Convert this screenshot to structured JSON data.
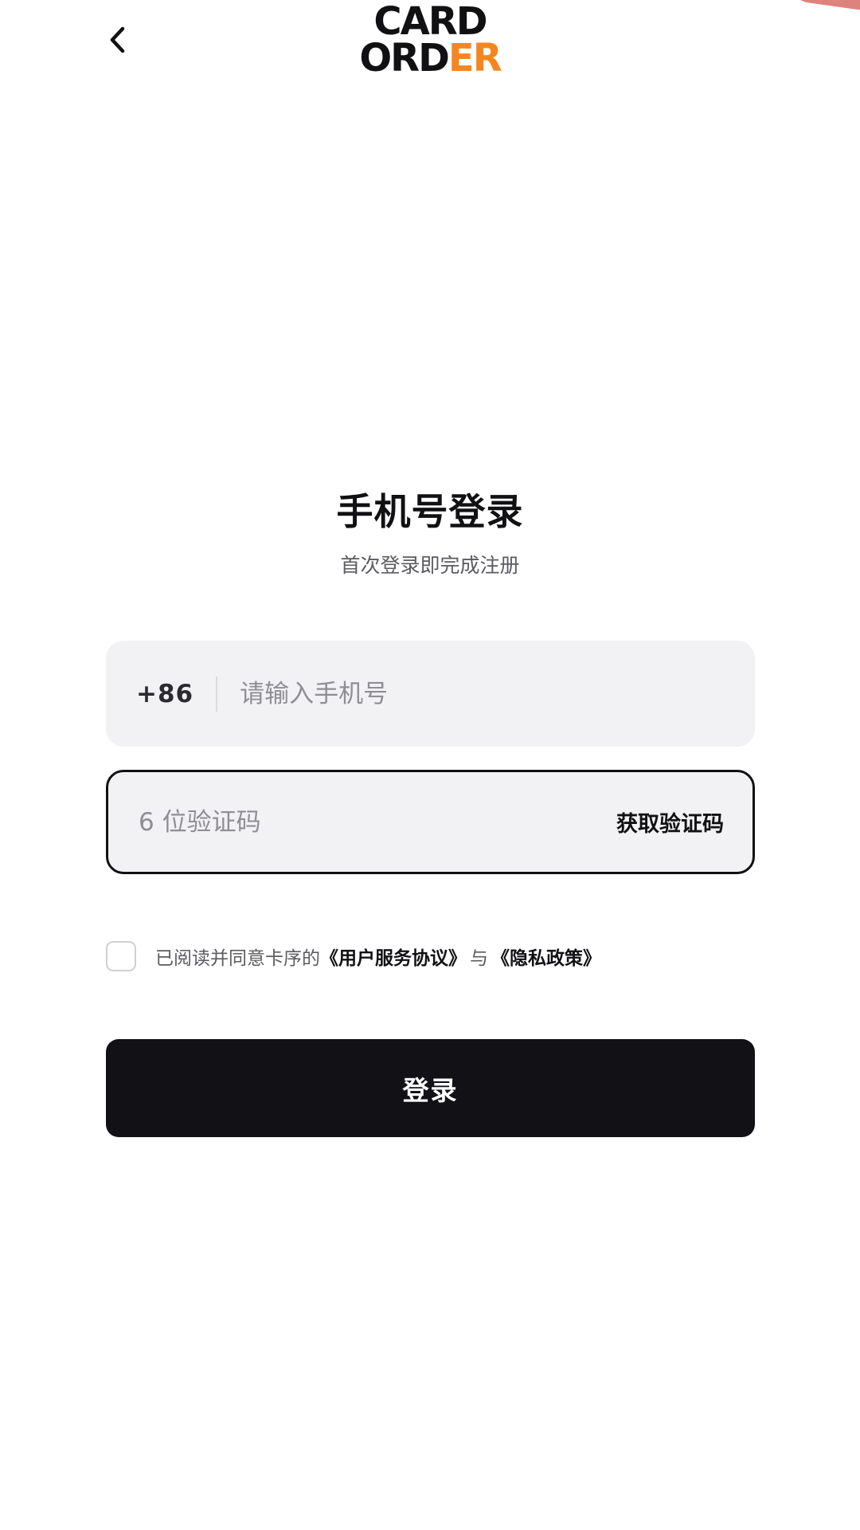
{
  "header": {
    "back_icon": "chevron-left-icon",
    "logo_line1": "CARD",
    "logo_line2_main": "ORD",
    "logo_line2_accent": "ER",
    "accent_color": "#f5861f"
  },
  "main": {
    "title": "手机号登录",
    "subtitle": "首次登录即完成注册",
    "phone": {
      "country_code": "+86",
      "placeholder": "请输入手机号",
      "value": ""
    },
    "code": {
      "placeholder": "6 位验证码",
      "value": "",
      "get_code_label": "获取验证码"
    },
    "agreement": {
      "checked": false,
      "prefix": "已阅读并同意卡序的",
      "terms_link": "《用户服务协议》",
      "conjunction": "与",
      "privacy_link": "《隐私政策》"
    },
    "login_label": "登录",
    "login_bg": "#111116"
  }
}
